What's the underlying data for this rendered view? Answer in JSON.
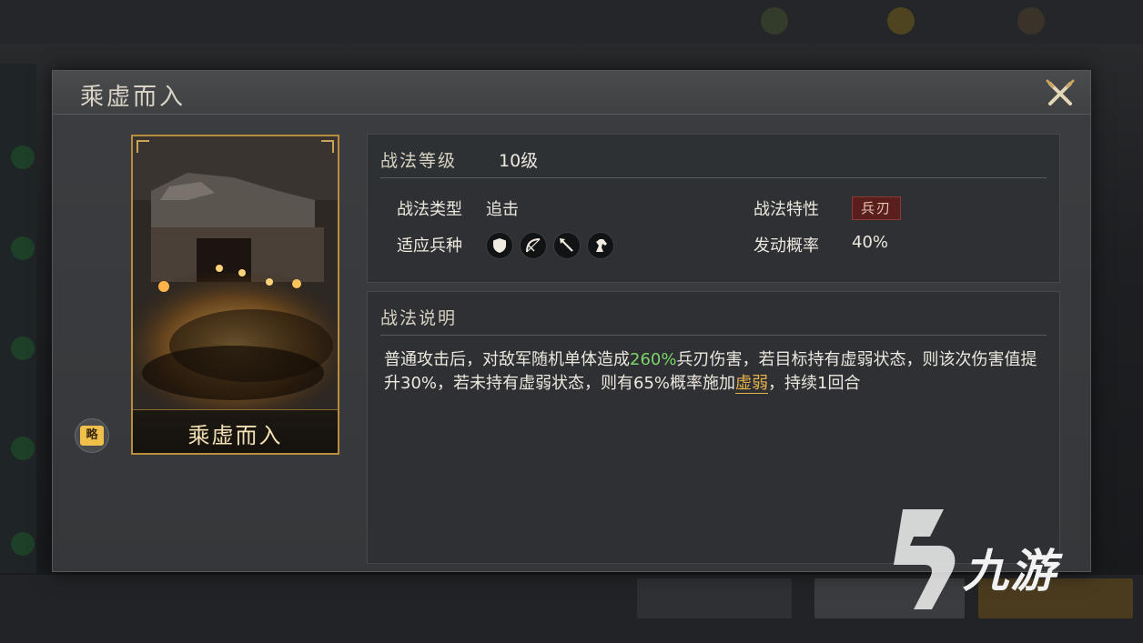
{
  "dialog": {
    "title": "乘虚而入"
  },
  "card": {
    "name": "乘虚而入",
    "badge": "略"
  },
  "info": {
    "level_label": "战法等级",
    "level_value": "10级",
    "type_label": "战法类型",
    "type_value": "追击",
    "trait_label": "战法特性",
    "trait_value": "兵刃",
    "troops_label": "适应兵种",
    "troops": [
      "shield-icon",
      "bow-icon",
      "spear-icon",
      "horse-icon"
    ],
    "rate_label": "发动概率",
    "rate_value": "40%"
  },
  "description": {
    "heading": "战法说明",
    "text_1": "普通攻击后，对敌军随机单体造成",
    "highlight_value": "260%",
    "text_2": "兵刃伤害，若目标持有虚弱状态，则该次伤害值提升30%，若未持有虚弱状态，则有65%概率施加",
    "link_text": "虚弱",
    "text_3": "，持续1回合"
  },
  "watermark": {
    "text": "九游"
  },
  "colors": {
    "accent_gold": "#b88e3e",
    "highlight_green": "#7ed46a",
    "link_gold": "#e6b24a",
    "trait_red": "#5a1f1c"
  }
}
